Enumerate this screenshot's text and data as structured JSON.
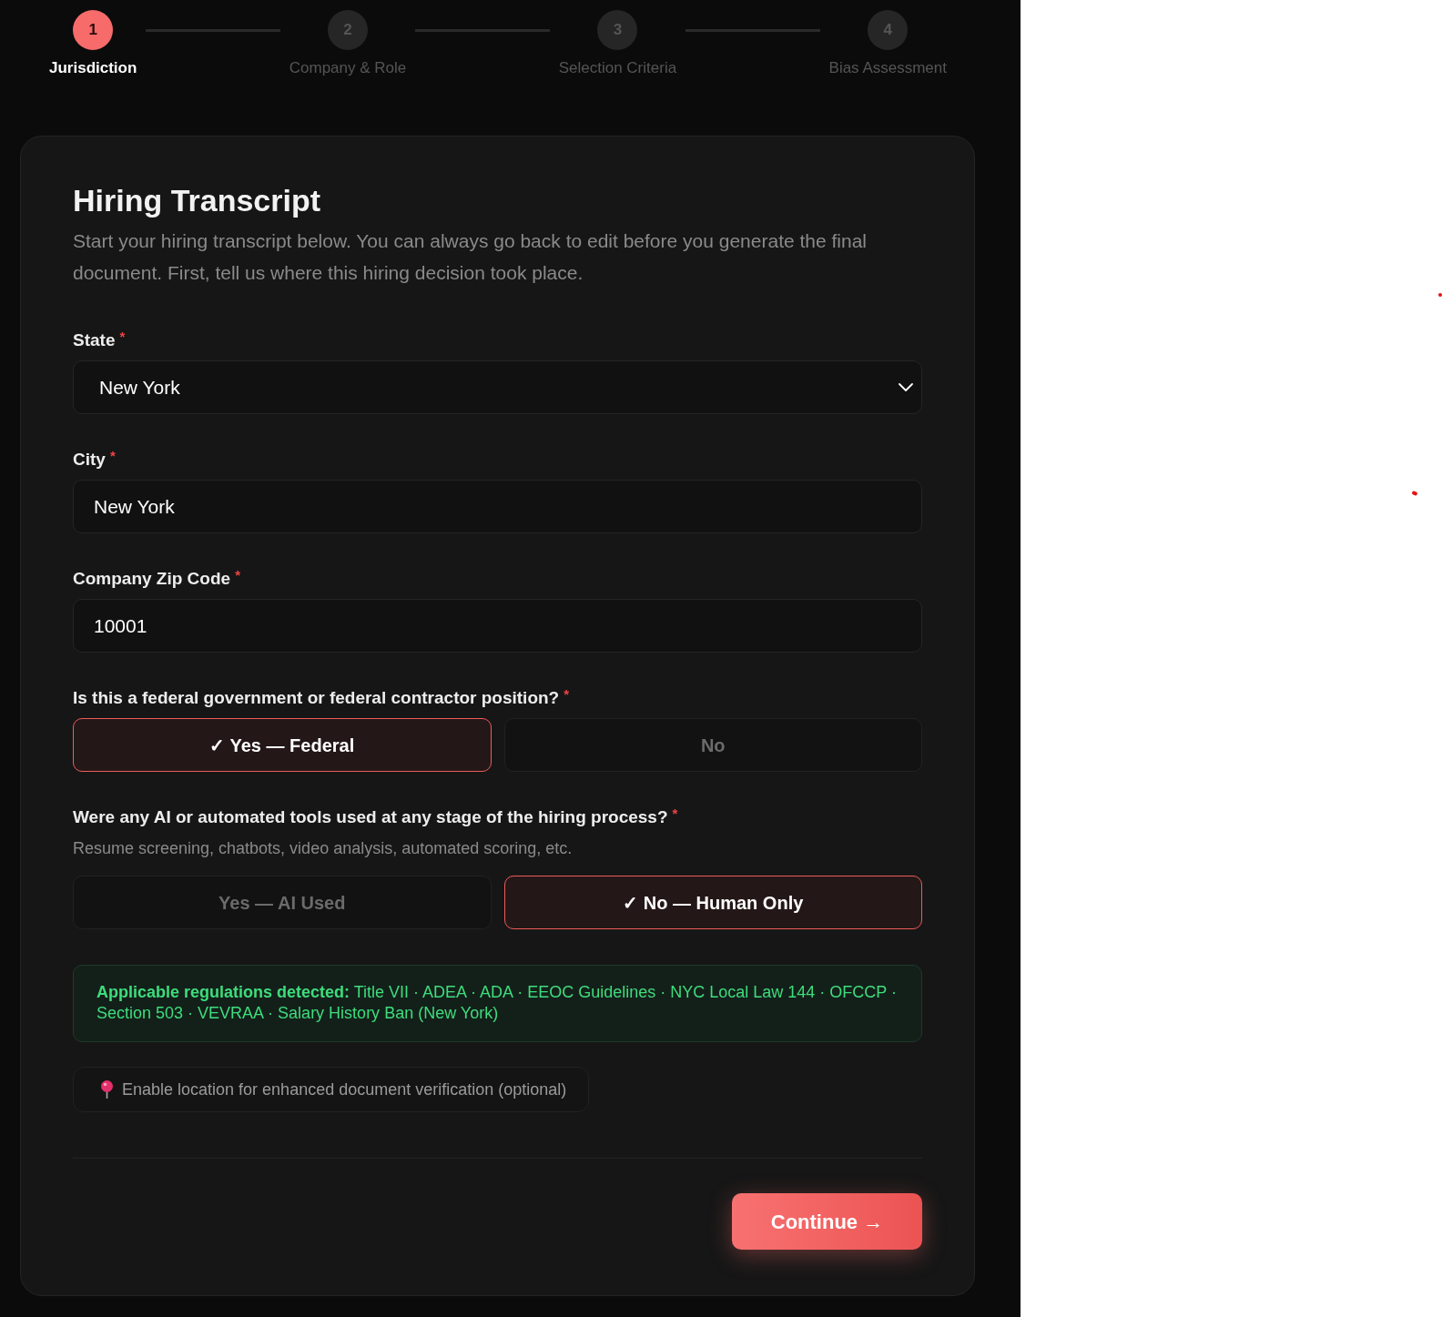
{
  "stepper": [
    {
      "number": "1",
      "label": "Jurisdiction",
      "selected": true
    },
    {
      "number": "2",
      "label": "Company & Role",
      "selected": false
    },
    {
      "number": "3",
      "label": "Selection Criteria",
      "selected": false
    },
    {
      "number": "4",
      "label": "Bias Assessment",
      "selected": false
    }
  ],
  "card": {
    "title": "Hiring Transcript",
    "subtitle": "Start your hiring transcript below. You can always go back to edit before you generate the final document. First, tell us where this hiring decision took place.",
    "fields": [
      {
        "kind": "select",
        "label": "State",
        "required_mark": "*",
        "value": "New York"
      },
      {
        "kind": "text",
        "label": "City",
        "required_mark": "*",
        "value": "New York"
      },
      {
        "kind": "text",
        "label": "Company Zip Code",
        "required_mark": "*",
        "value": "10001"
      }
    ],
    "questions": [
      {
        "label": "Is this a federal government or federal contractor position?",
        "required_mark": "*",
        "options": [
          {
            "label": "✓ Yes — Federal",
            "selected": true
          },
          {
            "label": "No",
            "selected": false
          }
        ]
      },
      {
        "label": "Were any AI or automated tools used at any stage of the hiring process?",
        "required_mark": "*",
        "hint": "Resume screening, chatbots, video analysis, automated scoring, etc.",
        "options": [
          {
            "label": "Yes — AI Used",
            "selected": false
          },
          {
            "label": "✓ No — Human Only",
            "selected": true
          }
        ]
      }
    ],
    "regulations": "**Applicable regulations detected:** Title VII · ADEA · ADA · EEOC Guidelines · NYC Local Law 144 · OFCCP · Section 503 · VEVRAA · Salary History Ban (New York)",
    "location_button": "Enable location for enhanced document verification (optional)",
    "continue_button": "Continue →"
  }
}
